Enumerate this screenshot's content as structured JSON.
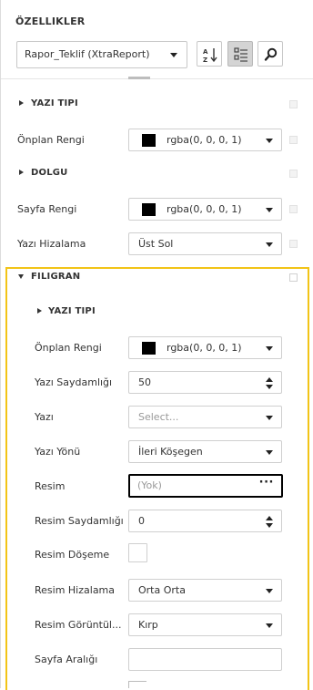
{
  "panel": {
    "title": "ÖZELLIKLER"
  },
  "report_selector": {
    "value": "Rapor_Teklif (XtraReport)"
  },
  "toolbar": {
    "sort_icon": "sort-az-icon",
    "categorized_icon": "categorized-list-icon",
    "search_icon": "search-icon"
  },
  "sections": {
    "yazi_tipi": "YAZI TIPI",
    "dolgu": "DOLGU",
    "filigran": "FILIGRAN",
    "filigran_yazi_tipi": "YAZI TIPI"
  },
  "rows": {
    "onplan_rengi": {
      "label": "Önplan Rengi",
      "value": "rgba(0, 0, 0, 1)",
      "swatch": "#000000"
    },
    "sayfa_rengi": {
      "label": "Sayfa Rengi",
      "value": "rgba(0, 0, 0, 1)",
      "swatch": "#000000"
    },
    "yazi_hizalama": {
      "label": "Yazı Hizalama",
      "value": "Üst Sol"
    }
  },
  "watermark": {
    "onplan_rengi": {
      "label": "Önplan Rengi",
      "value": "rgba(0, 0, 0, 1)",
      "swatch": "#000000"
    },
    "yazi_saydamligi": {
      "label": "Yazı Saydamlığı",
      "value": "50"
    },
    "yazi": {
      "label": "Yazı",
      "placeholder": "Select..."
    },
    "yazi_yonu": {
      "label": "Yazı Yönü",
      "value": "İleri Köşegen"
    },
    "resim": {
      "label": "Resim",
      "value": "(Yok)",
      "button": "···"
    },
    "resim_saydamligi": {
      "label": "Resim Saydamlığı",
      "value": "0"
    },
    "resim_doseme": {
      "label": "Resim Döşeme"
    },
    "resim_hizalama": {
      "label": "Resim Hizalama",
      "value": "Orta Orta"
    },
    "resim_goruntuleme": {
      "label": "Resim Görüntül...",
      "value": "Kırp"
    },
    "sayfa_araligi": {
      "label": "Sayfa Aralığı",
      "value": ""
    }
  },
  "colors": {
    "highlight": "#f2c417"
  }
}
